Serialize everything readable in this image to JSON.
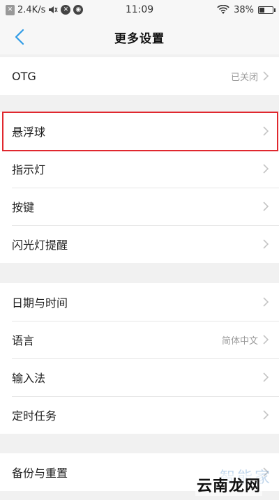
{
  "status_bar": {
    "speed": "2.4K/s",
    "time": "11:09",
    "battery": "38%",
    "battery_fraction": 0.38
  },
  "header": {
    "title": "更多设置"
  },
  "groups": [
    {
      "items": [
        {
          "label": "OTG",
          "value": "已关闭"
        }
      ]
    },
    {
      "items": [
        {
          "label": "悬浮球",
          "value": ""
        },
        {
          "label": "指示灯",
          "value": ""
        },
        {
          "label": "按键",
          "value": ""
        },
        {
          "label": "闪光灯提醒",
          "value": ""
        }
      ]
    },
    {
      "items": [
        {
          "label": "日期与时间",
          "value": ""
        },
        {
          "label": "语言",
          "value": "简体中文"
        },
        {
          "label": "输入法",
          "value": ""
        },
        {
          "label": "定时任务",
          "value": ""
        }
      ]
    },
    {
      "items": [
        {
          "label": "备份与重置",
          "value": ""
        }
      ]
    }
  ],
  "watermark": {
    "top": "智能家",
    "bottom": "云南龙网"
  },
  "colors": {
    "accent": "#2e9be6",
    "highlight": "#e0282e",
    "chevron": "#c4c4c4"
  }
}
